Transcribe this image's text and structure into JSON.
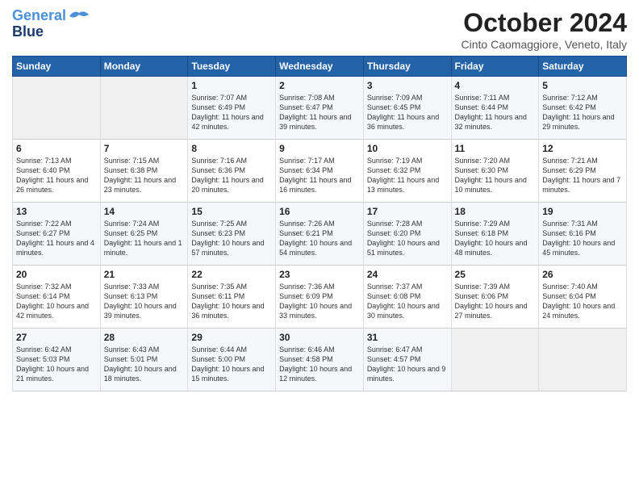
{
  "logo": {
    "line1": "General",
    "line2": "Blue"
  },
  "title": "October 2024",
  "subtitle": "Cinto Caomaggiore, Veneto, Italy",
  "days_header": [
    "Sunday",
    "Monday",
    "Tuesday",
    "Wednesday",
    "Thursday",
    "Friday",
    "Saturday"
  ],
  "weeks": [
    [
      {
        "day": "",
        "sunrise": "",
        "sunset": "",
        "daylight": "",
        "empty": true
      },
      {
        "day": "",
        "sunrise": "",
        "sunset": "",
        "daylight": "",
        "empty": true
      },
      {
        "day": "1",
        "sunrise": "Sunrise: 7:07 AM",
        "sunset": "Sunset: 6:49 PM",
        "daylight": "Daylight: 11 hours and 42 minutes."
      },
      {
        "day": "2",
        "sunrise": "Sunrise: 7:08 AM",
        "sunset": "Sunset: 6:47 PM",
        "daylight": "Daylight: 11 hours and 39 minutes."
      },
      {
        "day": "3",
        "sunrise": "Sunrise: 7:09 AM",
        "sunset": "Sunset: 6:45 PM",
        "daylight": "Daylight: 11 hours and 36 minutes."
      },
      {
        "day": "4",
        "sunrise": "Sunrise: 7:11 AM",
        "sunset": "Sunset: 6:44 PM",
        "daylight": "Daylight: 11 hours and 32 minutes."
      },
      {
        "day": "5",
        "sunrise": "Sunrise: 7:12 AM",
        "sunset": "Sunset: 6:42 PM",
        "daylight": "Daylight: 11 hours and 29 minutes."
      }
    ],
    [
      {
        "day": "6",
        "sunrise": "Sunrise: 7:13 AM",
        "sunset": "Sunset: 6:40 PM",
        "daylight": "Daylight: 11 hours and 26 minutes."
      },
      {
        "day": "7",
        "sunrise": "Sunrise: 7:15 AM",
        "sunset": "Sunset: 6:38 PM",
        "daylight": "Daylight: 11 hours and 23 minutes."
      },
      {
        "day": "8",
        "sunrise": "Sunrise: 7:16 AM",
        "sunset": "Sunset: 6:36 PM",
        "daylight": "Daylight: 11 hours and 20 minutes."
      },
      {
        "day": "9",
        "sunrise": "Sunrise: 7:17 AM",
        "sunset": "Sunset: 6:34 PM",
        "daylight": "Daylight: 11 hours and 16 minutes."
      },
      {
        "day": "10",
        "sunrise": "Sunrise: 7:19 AM",
        "sunset": "Sunset: 6:32 PM",
        "daylight": "Daylight: 11 hours and 13 minutes."
      },
      {
        "day": "11",
        "sunrise": "Sunrise: 7:20 AM",
        "sunset": "Sunset: 6:30 PM",
        "daylight": "Daylight: 11 hours and 10 minutes."
      },
      {
        "day": "12",
        "sunrise": "Sunrise: 7:21 AM",
        "sunset": "Sunset: 6:29 PM",
        "daylight": "Daylight: 11 hours and 7 minutes."
      }
    ],
    [
      {
        "day": "13",
        "sunrise": "Sunrise: 7:22 AM",
        "sunset": "Sunset: 6:27 PM",
        "daylight": "Daylight: 11 hours and 4 minutes."
      },
      {
        "day": "14",
        "sunrise": "Sunrise: 7:24 AM",
        "sunset": "Sunset: 6:25 PM",
        "daylight": "Daylight: 11 hours and 1 minute."
      },
      {
        "day": "15",
        "sunrise": "Sunrise: 7:25 AM",
        "sunset": "Sunset: 6:23 PM",
        "daylight": "Daylight: 10 hours and 57 minutes."
      },
      {
        "day": "16",
        "sunrise": "Sunrise: 7:26 AM",
        "sunset": "Sunset: 6:21 PM",
        "daylight": "Daylight: 10 hours and 54 minutes."
      },
      {
        "day": "17",
        "sunrise": "Sunrise: 7:28 AM",
        "sunset": "Sunset: 6:20 PM",
        "daylight": "Daylight: 10 hours and 51 minutes."
      },
      {
        "day": "18",
        "sunrise": "Sunrise: 7:29 AM",
        "sunset": "Sunset: 6:18 PM",
        "daylight": "Daylight: 10 hours and 48 minutes."
      },
      {
        "day": "19",
        "sunrise": "Sunrise: 7:31 AM",
        "sunset": "Sunset: 6:16 PM",
        "daylight": "Daylight: 10 hours and 45 minutes."
      }
    ],
    [
      {
        "day": "20",
        "sunrise": "Sunrise: 7:32 AM",
        "sunset": "Sunset: 6:14 PM",
        "daylight": "Daylight: 10 hours and 42 minutes."
      },
      {
        "day": "21",
        "sunrise": "Sunrise: 7:33 AM",
        "sunset": "Sunset: 6:13 PM",
        "daylight": "Daylight: 10 hours and 39 minutes."
      },
      {
        "day": "22",
        "sunrise": "Sunrise: 7:35 AM",
        "sunset": "Sunset: 6:11 PM",
        "daylight": "Daylight: 10 hours and 36 minutes."
      },
      {
        "day": "23",
        "sunrise": "Sunrise: 7:36 AM",
        "sunset": "Sunset: 6:09 PM",
        "daylight": "Daylight: 10 hours and 33 minutes."
      },
      {
        "day": "24",
        "sunrise": "Sunrise: 7:37 AM",
        "sunset": "Sunset: 6:08 PM",
        "daylight": "Daylight: 10 hours and 30 minutes."
      },
      {
        "day": "25",
        "sunrise": "Sunrise: 7:39 AM",
        "sunset": "Sunset: 6:06 PM",
        "daylight": "Daylight: 10 hours and 27 minutes."
      },
      {
        "day": "26",
        "sunrise": "Sunrise: 7:40 AM",
        "sunset": "Sunset: 6:04 PM",
        "daylight": "Daylight: 10 hours and 24 minutes."
      }
    ],
    [
      {
        "day": "27",
        "sunrise": "Sunrise: 6:42 AM",
        "sunset": "Sunset: 5:03 PM",
        "daylight": "Daylight: 10 hours and 21 minutes."
      },
      {
        "day": "28",
        "sunrise": "Sunrise: 6:43 AM",
        "sunset": "Sunset: 5:01 PM",
        "daylight": "Daylight: 10 hours and 18 minutes."
      },
      {
        "day": "29",
        "sunrise": "Sunrise: 6:44 AM",
        "sunset": "Sunset: 5:00 PM",
        "daylight": "Daylight: 10 hours and 15 minutes."
      },
      {
        "day": "30",
        "sunrise": "Sunrise: 6:46 AM",
        "sunset": "Sunset: 4:58 PM",
        "daylight": "Daylight: 10 hours and 12 minutes."
      },
      {
        "day": "31",
        "sunrise": "Sunrise: 6:47 AM",
        "sunset": "Sunset: 4:57 PM",
        "daylight": "Daylight: 10 hours and 9 minutes."
      },
      {
        "day": "",
        "sunrise": "",
        "sunset": "",
        "daylight": "",
        "empty": true
      },
      {
        "day": "",
        "sunrise": "",
        "sunset": "",
        "daylight": "",
        "empty": true
      }
    ]
  ]
}
